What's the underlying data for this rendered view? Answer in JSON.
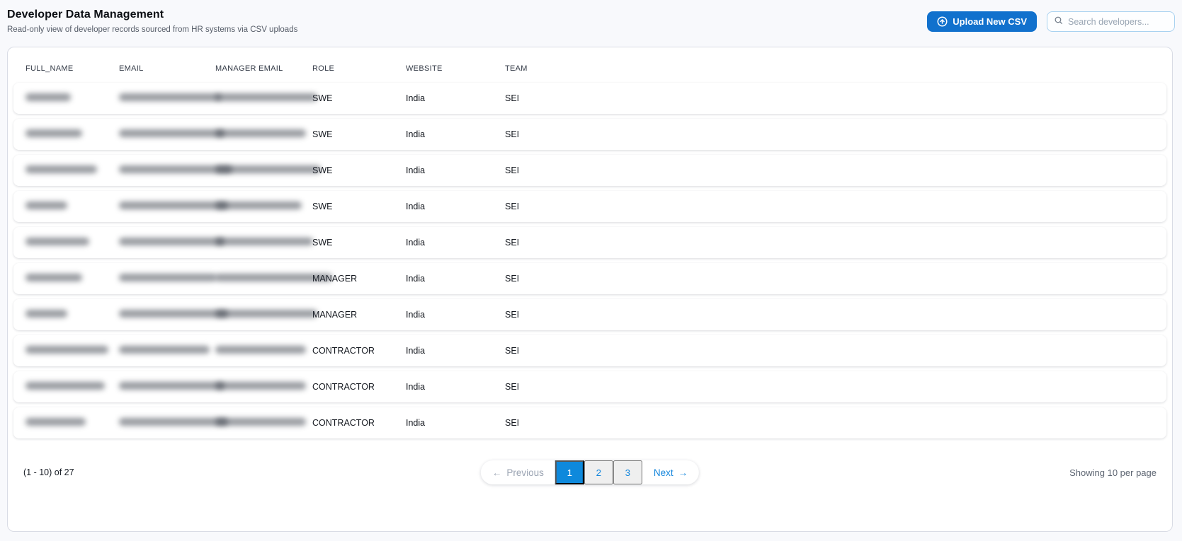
{
  "header": {
    "title": "Developer Data Management",
    "subtitle": "Read-only view of developer records sourced from HR systems via CSV uploads",
    "upload_button_label": "Upload New CSV",
    "search_placeholder": "Search developers...",
    "search_value": ""
  },
  "table": {
    "columns": [
      "FULL_NAME",
      "EMAIL",
      "MANAGER EMAIL",
      "ROLE",
      "WEBSITE",
      "TEAM"
    ],
    "rows": [
      {
        "full_name_redacted": true,
        "email_redacted": true,
        "manager_email_redacted": true,
        "role": "SWE",
        "website": "India",
        "team": "SEI",
        "redact_widths": {
          "name": 64,
          "email": 144,
          "manager": 144
        }
      },
      {
        "full_name_redacted": true,
        "email_redacted": true,
        "manager_email_redacted": true,
        "role": "SWE",
        "website": "India",
        "team": "SEI",
        "redact_widths": {
          "name": 80,
          "email": 149,
          "manager": 128
        }
      },
      {
        "full_name_redacted": true,
        "email_redacted": true,
        "manager_email_redacted": true,
        "role": "SWE",
        "website": "India",
        "team": "SEI",
        "redact_widths": {
          "name": 101,
          "email": 160,
          "manager": 149
        }
      },
      {
        "full_name_redacted": true,
        "email_redacted": true,
        "manager_email_redacted": true,
        "role": "SWE",
        "website": "India",
        "team": "SEI",
        "redact_widths": {
          "name": 59,
          "email": 154,
          "manager": 122
        }
      },
      {
        "full_name_redacted": true,
        "email_redacted": true,
        "manager_email_redacted": true,
        "role": "SWE",
        "website": "India",
        "team": "SEI",
        "redact_widths": {
          "name": 90,
          "email": 149,
          "manager": 138
        }
      },
      {
        "full_name_redacted": true,
        "email_redacted": true,
        "manager_email_redacted": true,
        "role": "MANAGER",
        "website": "India",
        "team": "SEI",
        "redact_widths": {
          "name": 80,
          "email": 138,
          "manager": 165
        }
      },
      {
        "full_name_redacted": true,
        "email_redacted": true,
        "manager_email_redacted": true,
        "role": "MANAGER",
        "website": "India",
        "team": "SEI",
        "redact_widths": {
          "name": 59,
          "email": 154,
          "manager": 144
        }
      },
      {
        "full_name_redacted": true,
        "email_redacted": true,
        "manager_email_redacted": true,
        "role": "CONTRACTOR",
        "website": "India",
        "team": "SEI",
        "redact_widths": {
          "name": 117,
          "email": 128,
          "manager": 128
        }
      },
      {
        "full_name_redacted": true,
        "email_redacted": true,
        "manager_email_redacted": true,
        "role": "CONTRACTOR",
        "website": "India",
        "team": "SEI",
        "redact_widths": {
          "name": 112,
          "email": 149,
          "manager": 128
        }
      },
      {
        "full_name_redacted": true,
        "email_redacted": true,
        "manager_email_redacted": true,
        "role": "CONTRACTOR",
        "website": "India",
        "team": "SEI",
        "redact_widths": {
          "name": 85,
          "email": 154,
          "manager": 128
        }
      }
    ]
  },
  "pagination": {
    "range_label": "(1 - 10) of 27",
    "prev_arrow": "←",
    "previous_label": "Previous",
    "pages": [
      "1",
      "2",
      "3"
    ],
    "active_page": "1",
    "next_label": "Next",
    "next_arrow": "→",
    "per_page_label": "Showing 10 per page"
  },
  "colors": {
    "accent_button": "#1171cd",
    "pagination_active": "#0e89dc",
    "link_blue": "#1486dc",
    "search_border": "#a9d2f0",
    "page_background": "#f8f9fc"
  }
}
